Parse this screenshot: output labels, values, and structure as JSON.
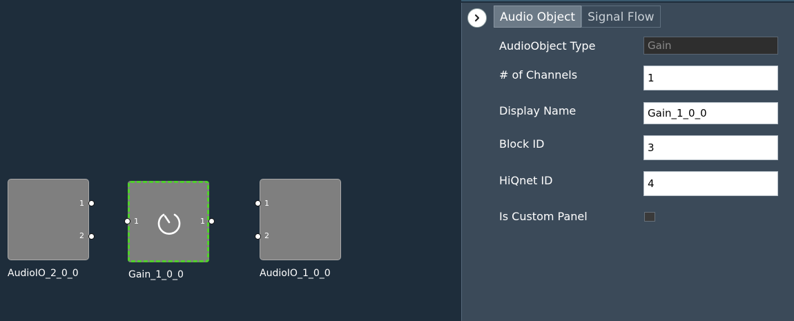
{
  "canvas": {
    "blocks": [
      {
        "name": "AudioIO_2_0_0",
        "outputs": [
          "1",
          "2"
        ],
        "inputs": [],
        "selected": false
      },
      {
        "name": "Gain_1_0_0",
        "inputs": [
          "1"
        ],
        "outputs": [
          "1"
        ],
        "icon": "gain-knob-icon",
        "selected": true,
        "selection_color": "#4fd12a"
      },
      {
        "name": "AudioIO_1_0_0",
        "inputs": [
          "1",
          "2"
        ],
        "outputs": [],
        "selected": false
      }
    ]
  },
  "panel": {
    "collapse_icon": "chevron-right-icon",
    "tabs": [
      {
        "label": "Audio Object",
        "active": true
      },
      {
        "label": "Signal Flow",
        "active": false
      }
    ],
    "properties": {
      "type_label": "AudioObject Type",
      "type_value": "Gain",
      "channels_label": "# of Channels",
      "channels_value": "1",
      "display_name_label": "Display Name",
      "display_name_value": "Gain_1_0_0",
      "block_id_label": "Block ID",
      "block_id_value": "3",
      "hiqnet_label": "HiQnet ID",
      "hiqnet_value": "4",
      "custom_panel_label": "Is Custom Panel",
      "custom_panel_checked": false
    }
  }
}
